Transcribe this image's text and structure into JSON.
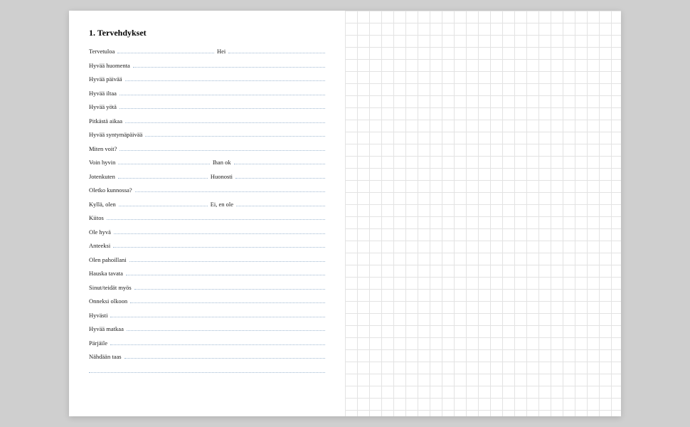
{
  "heading": "1. Tervehdykset",
  "rows": [
    {
      "cells": [
        "Tervetuloa",
        "Hei"
      ]
    },
    {
      "cells": [
        "Hyvää huomenta"
      ]
    },
    {
      "cells": [
        "Hyvää päivää"
      ]
    },
    {
      "cells": [
        "Hyvää iltaa"
      ]
    },
    {
      "cells": [
        "Hyvää yötä"
      ]
    },
    {
      "cells": [
        "Pitkästä aikaa"
      ]
    },
    {
      "cells": [
        "Hyvää syntymäpäivää"
      ]
    },
    {
      "cells": [
        "Miten voit?"
      ]
    },
    {
      "cells": [
        "Voin hyvin",
        "Ihan ok"
      ]
    },
    {
      "cells": [
        "Jotenkuten",
        "Huonosti"
      ]
    },
    {
      "cells": [
        "Oletko kunnossa?"
      ]
    },
    {
      "cells": [
        "Kyllä, olen",
        "Ei, en ole"
      ]
    },
    {
      "cells": [
        "Kiitos"
      ]
    },
    {
      "cells": [
        "Ole hyvä"
      ]
    },
    {
      "cells": [
        "Anteeksi"
      ]
    },
    {
      "cells": [
        "Olen pahoillani"
      ]
    },
    {
      "cells": [
        "Hauska tavata"
      ]
    },
    {
      "cells": [
        "Sinut/teidät myös"
      ]
    },
    {
      "cells": [
        "Onneksi olkoon"
      ]
    },
    {
      "cells": [
        "Hyvästi"
      ]
    },
    {
      "cells": [
        "Hyvää matkaa"
      ]
    },
    {
      "cells": [
        "Pärjäile"
      ]
    },
    {
      "cells": [
        "Nähdään taas"
      ]
    },
    {
      "cells": [
        ""
      ]
    }
  ]
}
